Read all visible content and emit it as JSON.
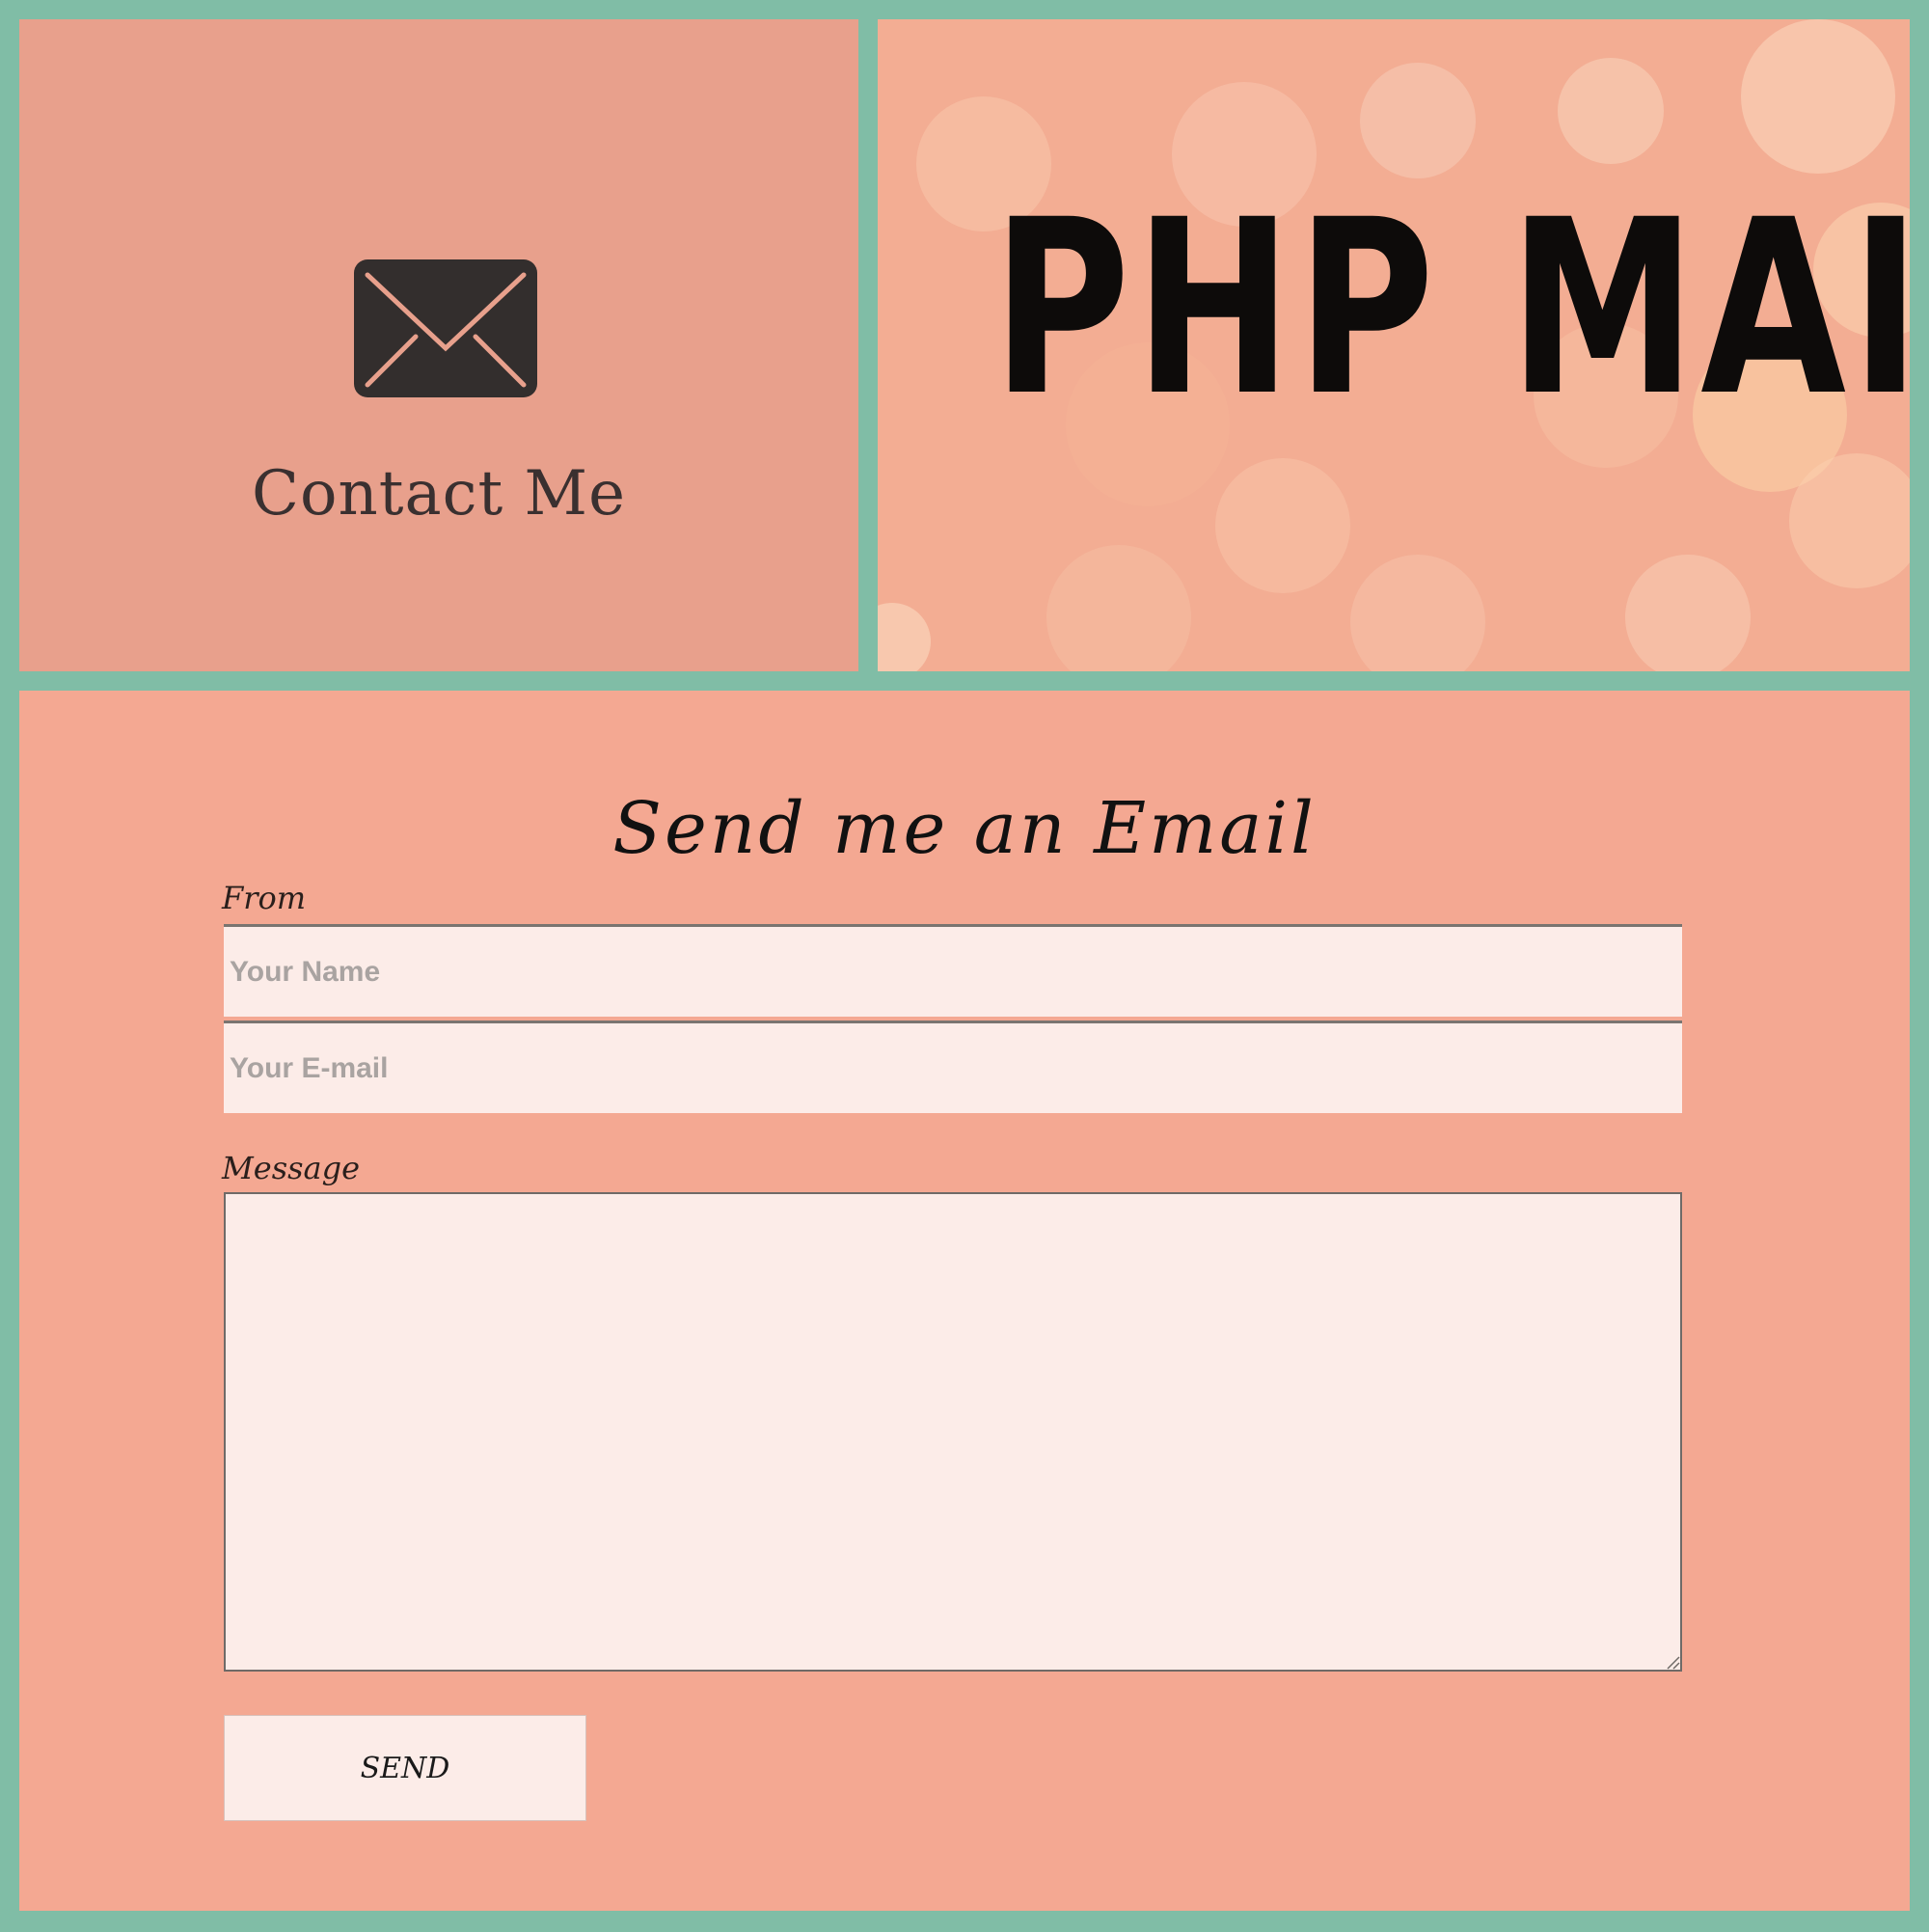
{
  "contact": {
    "icon": "envelope-icon",
    "title": "Contact Me"
  },
  "banner": {
    "title": "PHP MAIL"
  },
  "form": {
    "heading": "Send me an Email",
    "from_label": "From",
    "name_placeholder": "Your Name",
    "email_placeholder": "Your E-mail",
    "message_label": "Message",
    "message_value": "",
    "send_label": "SEND"
  },
  "colors": {
    "page_background": "#80bda6",
    "contact_panel": "#e8a08c",
    "banner_panel": "#f3ad93",
    "form_panel": "#f4a892",
    "field_background": "#fcece8",
    "icon_dark": "#332e2d"
  }
}
